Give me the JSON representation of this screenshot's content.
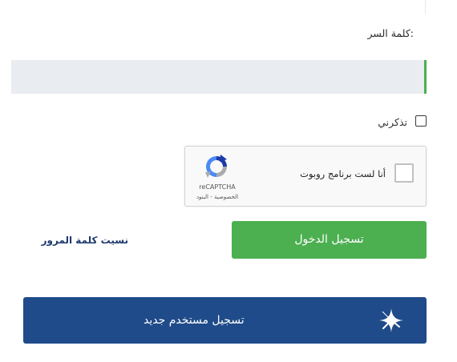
{
  "form": {
    "password_label": "كلمة السر:",
    "password_value": "",
    "remember_label": "تذكرني",
    "remember_checked": false
  },
  "captcha": {
    "prompt": "أنا لست برنامج روبوت",
    "brand": "reCAPTCHA",
    "privacy_terms": "الخصوصية - البنود",
    "logo_icon": "recaptcha-logo-icon"
  },
  "actions": {
    "login_label": "تسجيل الدخول",
    "forgot_label": "نسيت كلمة المرور",
    "register_label": "تسجيل مستخدم جديد",
    "register_icon": "sparkle-icon"
  },
  "colors": {
    "accent_green": "#4caf50",
    "brand_blue": "#1f4b8a",
    "link_blue": "#1e3a6e",
    "field_bg": "#e9ecf0"
  }
}
